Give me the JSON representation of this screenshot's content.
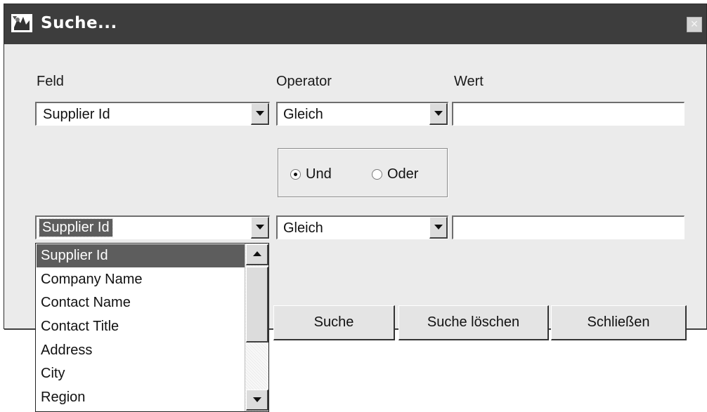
{
  "window": {
    "title": "Suche...",
    "close_glyph": "✕",
    "icon": "app-icon"
  },
  "headers": {
    "field": "Feld",
    "operator": "Operator",
    "value": "Wert"
  },
  "row1": {
    "field_value": "Supplier Id",
    "operator_value": "Gleich",
    "value_text": ""
  },
  "logic": {
    "and_label": "Und",
    "or_label": "Oder",
    "selected": "Und"
  },
  "row2": {
    "field_value": "Supplier Id",
    "operator_value": "Gleich",
    "value_text": ""
  },
  "dropdown": {
    "items": [
      {
        "label": "Supplier Id",
        "selected": true
      },
      {
        "label": "Company Name",
        "selected": false
      },
      {
        "label": "Contact Name",
        "selected": false
      },
      {
        "label": "Contact Title",
        "selected": false
      },
      {
        "label": "Address",
        "selected": false
      },
      {
        "label": "City",
        "selected": false
      },
      {
        "label": "Region",
        "selected": false
      }
    ]
  },
  "buttons": {
    "search": "Suche",
    "clear": "Suche löschen",
    "close": "Schließen"
  }
}
